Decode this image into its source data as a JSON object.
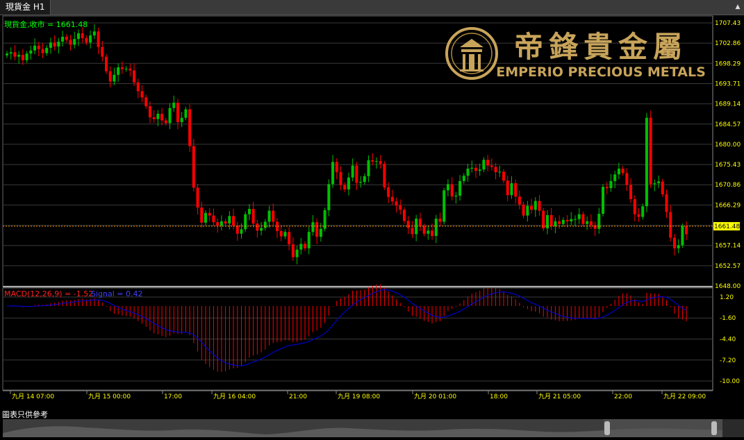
{
  "tab": {
    "title": "現貨金 H1"
  },
  "header": {
    "symbol_label": "現貨金,收市 = 1661.48"
  },
  "logo": {
    "chinese": "帝鋒貴金屬",
    "english": "EMPERIO PRECIOUS METALS"
  },
  "price_axis": {
    "labels": [
      "1707.43",
      "1702.86",
      "1698.29",
      "1693.71",
      "1689.14",
      "1684.57",
      "1680.00",
      "1675.43",
      "1670.86",
      "1666.29",
      "1661.71",
      "1657.14",
      "1652.57",
      "1648.00"
    ],
    "current": "1661.48"
  },
  "macd": {
    "label": "MACD(12,26,9) = -1.52",
    "signal_label": "Signal = 0.42",
    "axis_labels": [
      "1.20",
      "-1.60",
      "-4.40",
      "-7.20",
      "-10.00"
    ]
  },
  "time_axis": {
    "labels": [
      "九月 14 07:00",
      "九月 15 00:00",
      "17:00",
      "九月 16 04:00",
      "21:00",
      "九月 19 08:00",
      "九月 20 01:00",
      "18:00",
      "九月 21 05:00",
      "22:00",
      "九月 22 09:00"
    ]
  },
  "footer": {
    "note": "圖表只供參考"
  },
  "colors": {
    "up": "#00c000",
    "down": "#ff0000",
    "macd_hist": "#ff0000",
    "signal": "#0000cc",
    "axis_text": "#ffff00",
    "label_green": "#00ff00",
    "current_line": "#ff9900",
    "logo_gold": "#c8a45a"
  },
  "chart_data": {
    "type": "candlestick",
    "title": "現貨金 H1",
    "close": 1661.48,
    "ylim": [
      1648.0,
      1709.0
    ],
    "x_ticks": [
      "九月 14 07:00",
      "九月 15 00:00",
      "17:00",
      "九月 16 04:00",
      "21:00",
      "九月 19 08:00",
      "九月 20 01:00",
      "18:00",
      "九月 21 05:00",
      "22:00",
      "九月 22 09:00"
    ],
    "close_series": [
      1700.5,
      1700.8,
      1699.8,
      1700.2,
      1699.0,
      1700.5,
      1701.2,
      1702.3,
      1701.5,
      1700.6,
      1701.8,
      1703.0,
      1702.1,
      1703.2,
      1704.3,
      1703.6,
      1702.5,
      1703.8,
      1705.1,
      1704.0,
      1703.0,
      1704.6,
      1705.5,
      1702.0,
      1699.8,
      1696.5,
      1694.2,
      1695.7,
      1697.4,
      1697.0,
      1697.1,
      1696.7,
      1694.0,
      1692.0,
      1690.6,
      1688.6,
      1686.1,
      1685.7,
      1686.9,
      1685.4,
      1684.8,
      1688.2,
      1689.4,
      1685.0,
      1686.0,
      1687.9,
      1679.6,
      1670.2,
      1665.7,
      1662.3,
      1664.5,
      1663.9,
      1662.4,
      1661.6,
      1662.6,
      1662.1,
      1663.8,
      1661.6,
      1659.8,
      1660.8,
      1664.2,
      1665.4,
      1662.1,
      1660.5,
      1661.1,
      1662.5,
      1665.0,
      1662.5,
      1660.4,
      1659.2,
      1660.2,
      1657.4,
      1654.5,
      1656.2,
      1657.5,
      1656.5,
      1660.2,
      1662.4,
      1659.1,
      1660.9,
      1665.1,
      1671.0,
      1676.0,
      1673.7,
      1670.8,
      1669.8,
      1672.5,
      1675.2,
      1671.3,
      1671.5,
      1672.8,
      1676.4,
      1676.1,
      1676.2,
      1675.6,
      1670.3,
      1668.1,
      1667.1,
      1666.2,
      1665.2,
      1662.7,
      1661.1,
      1659.7,
      1663.2,
      1661.5,
      1659.8,
      1660.5,
      1659.3,
      1663.2,
      1662.5,
      1669.6,
      1671.0,
      1668.2,
      1668.4,
      1671.7,
      1672.9,
      1674.5,
      1674.7,
      1674.0,
      1674.3,
      1676.5,
      1675.2,
      1674.9,
      1673.7,
      1673.8,
      1671.8,
      1668.5,
      1671.2,
      1668.2,
      1666.4,
      1663.9,
      1666.1,
      1665.2,
      1667.2,
      1665.0,
      1661.0,
      1664.0,
      1661.5,
      1662.6,
      1662.0,
      1662.9,
      1662.6,
      1663.1,
      1663.1,
      1664.2,
      1662.0,
      1662.6,
      1661.7,
      1660.9,
      1664.3,
      1670.4,
      1670.1,
      1671.7,
      1673.2,
      1674.5,
      1673.5,
      1670.8,
      1667.6,
      1664.2,
      1663.6,
      1666.0,
      1686.0,
      1671.0,
      1671.2,
      1671.6,
      1668.7,
      1664.7,
      1658.9,
      1656.5,
      1657.2,
      1661.5,
      1659.7
    ]
  }
}
